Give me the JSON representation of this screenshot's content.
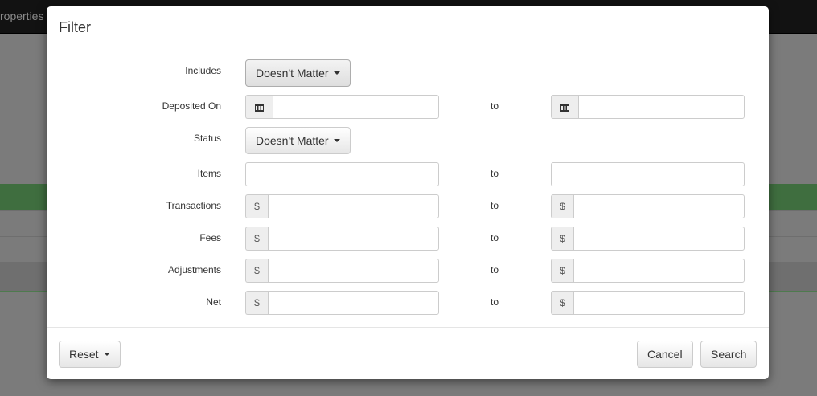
{
  "background": {
    "topbar_text": "roperties"
  },
  "modal": {
    "title": "Filter",
    "to_label": "to",
    "rows": {
      "includes": {
        "label": "Includes",
        "value": "Doesn't Matter"
      },
      "deposited_on": {
        "label": "Deposited On",
        "from_value": "",
        "to_value": "",
        "icon": "calendar-icon"
      },
      "status": {
        "label": "Status",
        "value": "Doesn't Matter"
      },
      "items": {
        "label": "Items",
        "from_value": "",
        "to_value": ""
      },
      "transactions": {
        "label": "Transactions",
        "prefix": "$",
        "from_value": "",
        "to_value": ""
      },
      "fees": {
        "label": "Fees",
        "prefix": "$",
        "from_value": "",
        "to_value": ""
      },
      "adjustments": {
        "label": "Adjustments",
        "prefix": "$",
        "from_value": "",
        "to_value": ""
      },
      "net": {
        "label": "Net",
        "prefix": "$",
        "from_value": "",
        "to_value": ""
      }
    },
    "footer": {
      "reset_label": "Reset",
      "cancel_label": "Cancel",
      "search_label": "Search"
    }
  },
  "colors": {
    "overlay": "#7b7b7b",
    "accent_green": "#3f6e3f"
  }
}
